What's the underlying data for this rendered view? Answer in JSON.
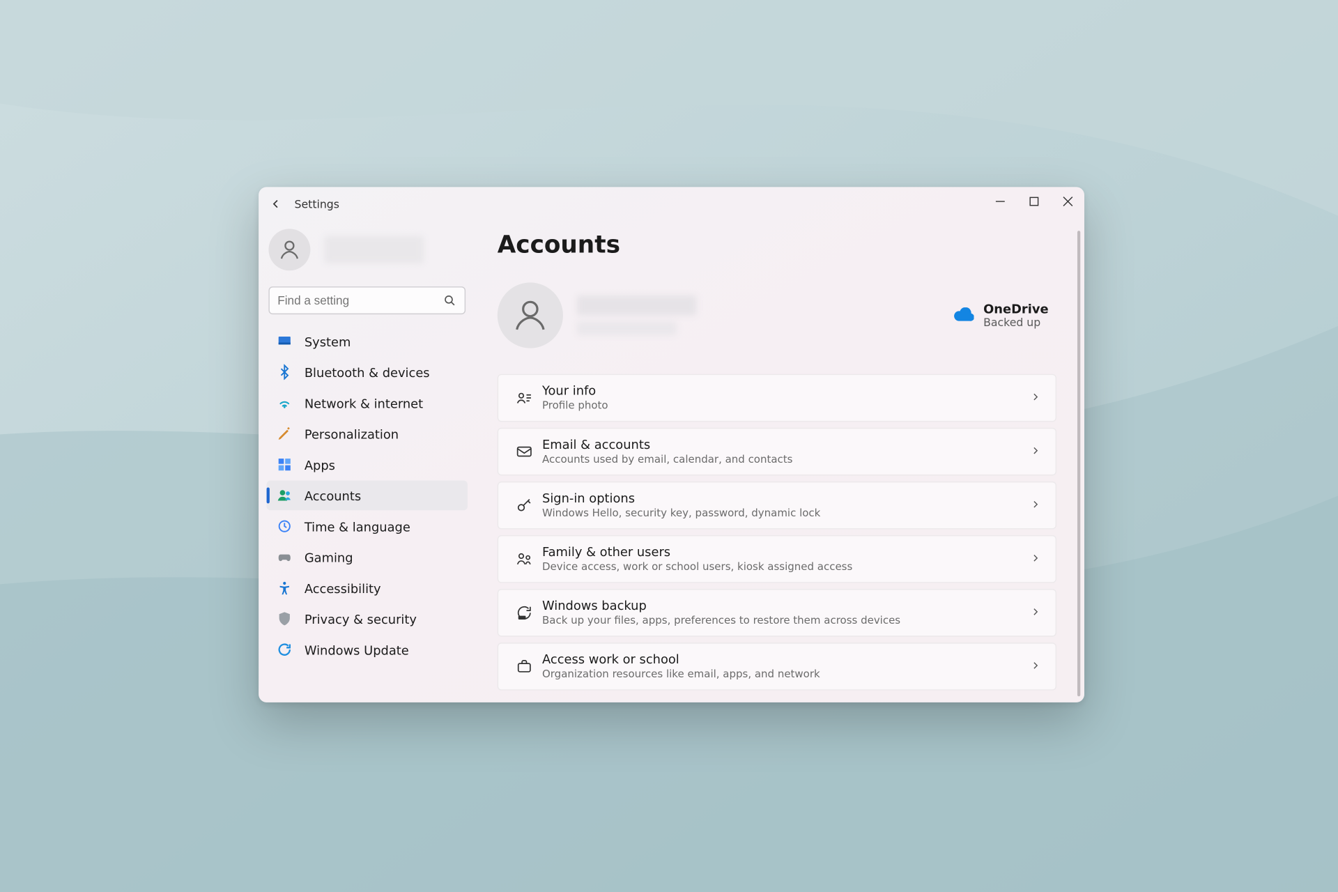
{
  "app": {
    "title": "Settings"
  },
  "search": {
    "placeholder": "Find a setting"
  },
  "sidebar": {
    "items": [
      {
        "label": "System"
      },
      {
        "label": "Bluetooth & devices"
      },
      {
        "label": "Network & internet"
      },
      {
        "label": "Personalization"
      },
      {
        "label": "Apps"
      },
      {
        "label": "Accounts"
      },
      {
        "label": "Time & language"
      },
      {
        "label": "Gaming"
      },
      {
        "label": "Accessibility"
      },
      {
        "label": "Privacy & security"
      },
      {
        "label": "Windows Update"
      }
    ],
    "selected_index": 5
  },
  "page": {
    "title": "Accounts"
  },
  "onedrive": {
    "title": "OneDrive",
    "status": "Backed up"
  },
  "cards": [
    {
      "title": "Your info",
      "subtitle": "Profile photo"
    },
    {
      "title": "Email & accounts",
      "subtitle": "Accounts used by email, calendar, and contacts"
    },
    {
      "title": "Sign-in options",
      "subtitle": "Windows Hello, security key, password, dynamic lock"
    },
    {
      "title": "Family & other users",
      "subtitle": "Device access, work or school users, kiosk assigned access"
    },
    {
      "title": "Windows backup",
      "subtitle": "Back up your files, apps, preferences to restore them across devices"
    },
    {
      "title": "Access work or school",
      "subtitle": "Organization resources like email, apps, and network"
    }
  ]
}
